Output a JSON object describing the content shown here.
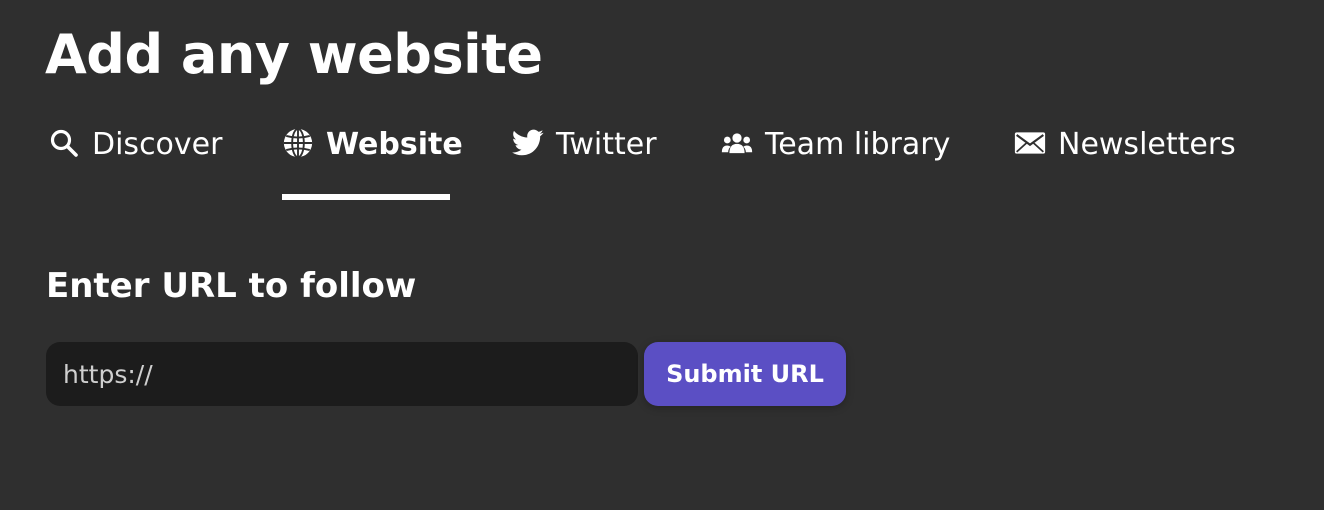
{
  "page": {
    "title": "Add any website",
    "background": "#2f2f2f"
  },
  "tabs": [
    {
      "label": "Discover",
      "icon": "search-icon",
      "active": false
    },
    {
      "label": "Website",
      "icon": "globe-icon",
      "active": true
    },
    {
      "label": "Twitter",
      "icon": "twitter-bird-icon",
      "active": false
    },
    {
      "label": "Team library",
      "icon": "team-icon",
      "active": false
    },
    {
      "label": "Newsletters",
      "icon": "envelope-icon",
      "active": false
    }
  ],
  "form": {
    "heading": "Enter URL to follow",
    "url_input": {
      "value": "",
      "placeholder": "https://"
    },
    "submit_label": "Submit URL",
    "accent_color": "#5b4fc4"
  }
}
